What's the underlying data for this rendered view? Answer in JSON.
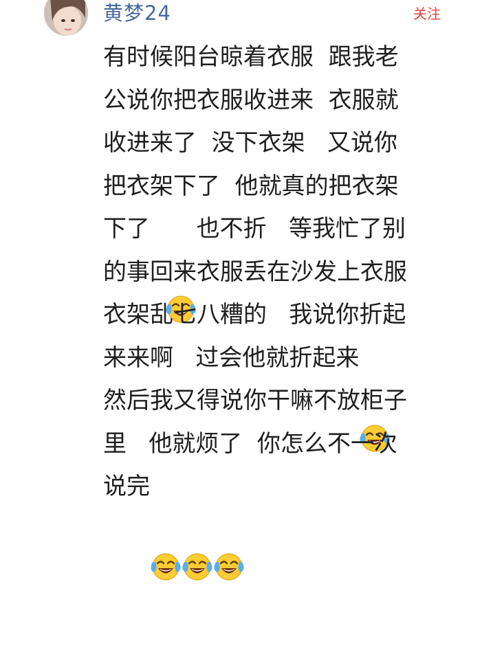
{
  "user": {
    "name": "黄梦24",
    "follow_label": "关注"
  },
  "comment": {
    "lines": [
      {
        "segments": [
          {
            "type": "text",
            "value": "有时候阳台晾着衣服  跟我老"
          }
        ]
      },
      {
        "segments": [
          {
            "type": "text",
            "value": "公说你把衣服收进来  衣服就"
          }
        ]
      },
      {
        "segments": [
          {
            "type": "text",
            "value": "收进来了  没下衣架   又说你"
          }
        ]
      },
      {
        "segments": [
          {
            "type": "text",
            "value": "把衣架下了  他就真的把衣架"
          }
        ]
      },
      {
        "segments": [
          {
            "type": "text",
            "value": "下了  "
          },
          {
            "type": "emoji",
            "icon": "tears-of-joy-icon"
          },
          {
            "type": "text",
            "value": "也不折   等我忙了别"
          }
        ]
      },
      {
        "segments": [
          {
            "type": "text",
            "value": "的事回来衣服丢在沙发上衣服"
          }
        ]
      },
      {
        "segments": [
          {
            "type": "text",
            "value": "衣架乱七八糟的   我说你折起"
          }
        ]
      },
      {
        "segments": [
          {
            "type": "text",
            "value": "来来啊   过会他就折起来"
          },
          {
            "type": "emoji",
            "icon": "tears-of-joy-icon"
          }
        ]
      },
      {
        "segments": [
          {
            "type": "text",
            "value": "然后我又得说你干嘛不放柜子"
          }
        ]
      },
      {
        "segments": [
          {
            "type": "text",
            "value": "里   他就烦了  你怎么不一次"
          }
        ]
      },
      {
        "segments": [
          {
            "type": "text",
            "value": "说完"
          },
          {
            "type": "emoji",
            "icon": "tears-of-joy-icon"
          },
          {
            "type": "emoji",
            "icon": "tears-of-joy-icon"
          },
          {
            "type": "emoji",
            "icon": "tears-of-joy-icon"
          }
        ]
      }
    ]
  },
  "colors": {
    "username": "#47679c",
    "follow": "#e2433e",
    "text": "#1e1e1e",
    "emoji_face": "#ffcc33",
    "emoji_tear": "#5aaeea"
  }
}
